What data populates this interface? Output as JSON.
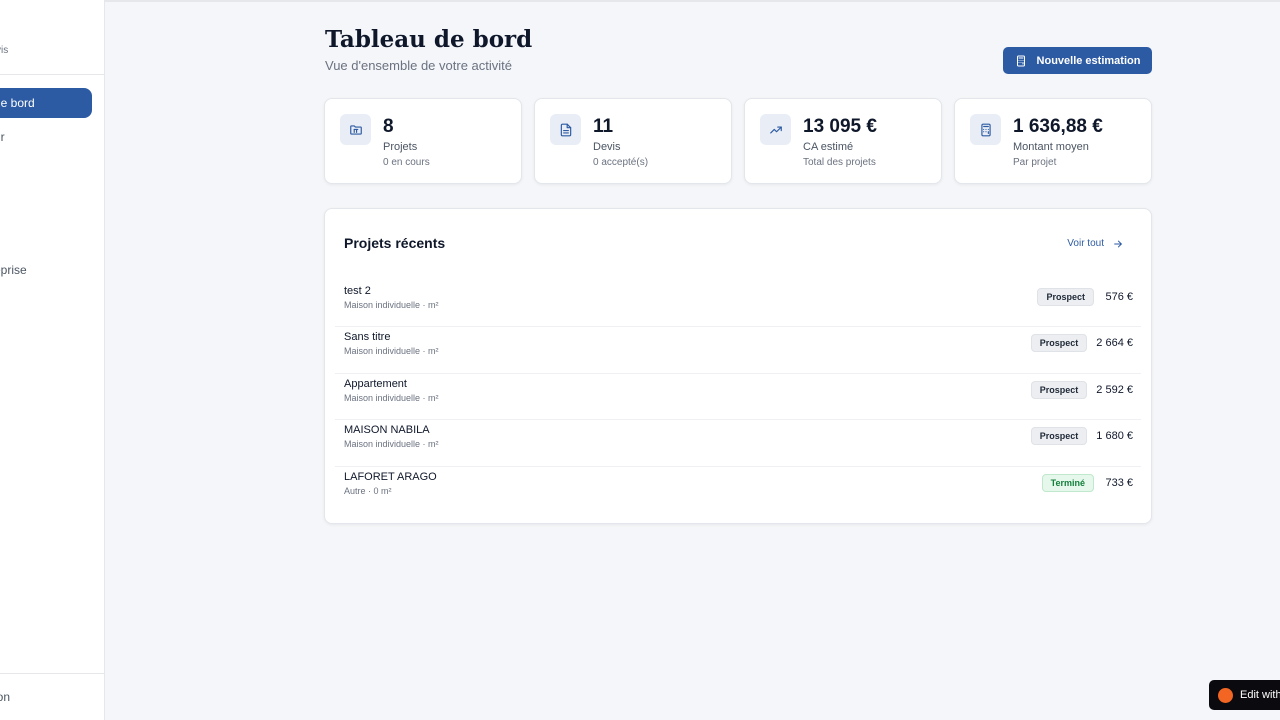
{
  "sidebar": {
    "brand": ".",
    "brand_sub": "vis",
    "items": [
      {
        "label": "de bord",
        "active": true
      },
      {
        "label": "ur",
        "active": false
      },
      {
        "label": "eprise",
        "active": false
      }
    ],
    "footer": "ion"
  },
  "header": {
    "title": "Tableau de bord",
    "subtitle": "Vue d'ensemble de votre activité",
    "new_button": "Nouvelle estimation",
    "new_button_icon": "calculator-icon"
  },
  "stats": [
    {
      "icon": "folder-icon",
      "value": "8",
      "label": "Projets",
      "hint": "0 en cours"
    },
    {
      "icon": "document-icon",
      "value": "11",
      "label": "Devis",
      "hint": "0 accepté(s)"
    },
    {
      "icon": "trending-up-icon",
      "value": "13 095 €",
      "label": "CA estimé",
      "hint": "Total des projets"
    },
    {
      "icon": "calculator-icon",
      "value": "1 636,88 €",
      "label": "Montant moyen",
      "hint": "Par projet"
    }
  ],
  "recent": {
    "title": "Projets récents",
    "see_all": "Voir tout",
    "rows": [
      {
        "name": "test 2",
        "meta": "Maison individuelle · m²",
        "status": "Prospect",
        "amount": "576 €"
      },
      {
        "name": "Sans titre",
        "meta": "Maison individuelle · m²",
        "status": "Prospect",
        "amount": "2 664 €"
      },
      {
        "name": "Appartement",
        "meta": "Maison individuelle · m²",
        "status": "Prospect",
        "amount": "2 592 €"
      },
      {
        "name": "MAISON NABILA",
        "meta": "Maison individuelle · m²",
        "status": "Prospect",
        "amount": "1 680 €"
      },
      {
        "name": "LAFORET ARAGO",
        "meta": "Autre · 0 m²",
        "status": "Terminé",
        "amount": "733 €"
      }
    ]
  },
  "edit_widget": {
    "label": "Edit with"
  },
  "colors": {
    "primary": "#2d5ba3",
    "background": "#f4f6f9",
    "done_badge": "#e6f7ec",
    "prospect_badge": "#eceef1"
  }
}
